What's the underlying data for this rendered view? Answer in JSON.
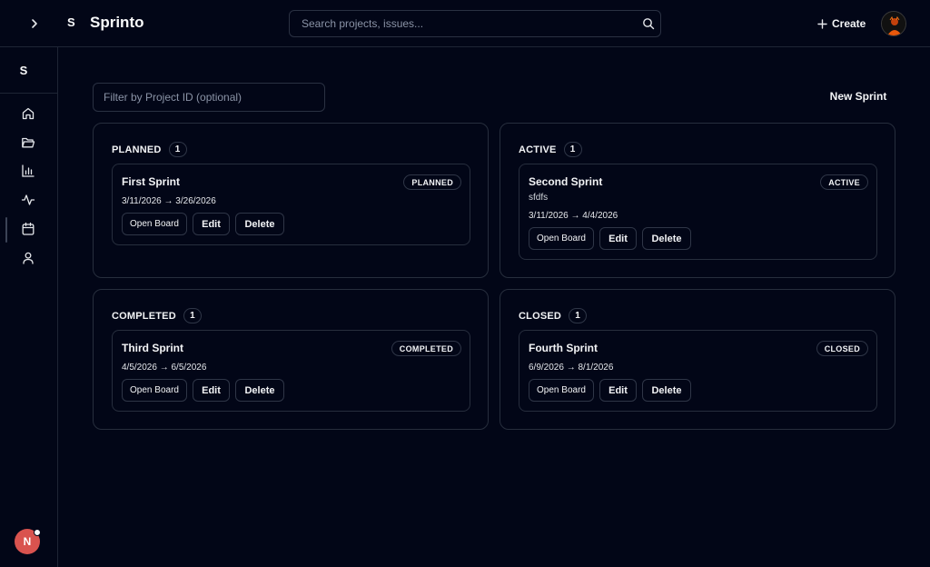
{
  "header": {
    "brand_initial": "S",
    "brand_name": "Sprinto",
    "search_placeholder": "Search projects, issues...",
    "create_label": "Create"
  },
  "sidebar": {
    "initial": "S",
    "items": [
      {
        "icon": "home-icon"
      },
      {
        "icon": "folder-icon"
      },
      {
        "icon": "bar-chart-icon"
      },
      {
        "icon": "activity-icon"
      },
      {
        "icon": "calendar-icon"
      },
      {
        "icon": "user-icon"
      }
    ],
    "active_index": 4,
    "user_initial": "N"
  },
  "toolbar": {
    "filter_placeholder": "Filter by Project ID (optional)",
    "new_sprint_label": "New Sprint"
  },
  "columns": [
    {
      "title": "PLANNED",
      "count": "1",
      "sprints": [
        {
          "name": "First Sprint",
          "status": "PLANNED",
          "description": "",
          "dates": "3/11/2026 → 3/26/2026"
        }
      ]
    },
    {
      "title": "ACTIVE",
      "count": "1",
      "sprints": [
        {
          "name": "Second Sprint",
          "status": "ACTIVE",
          "description": "sfdfs",
          "dates": "3/11/2026 → 4/4/2026"
        }
      ]
    },
    {
      "title": "COMPLETED",
      "count": "1",
      "sprints": [
        {
          "name": "Third Sprint",
          "status": "COMPLETED",
          "description": "",
          "dates": "4/5/2026 → 6/5/2026"
        }
      ]
    },
    {
      "title": "CLOSED",
      "count": "1",
      "sprints": [
        {
          "name": "Fourth Sprint",
          "status": "CLOSED",
          "description": "",
          "dates": "6/9/2026 → 8/1/2026"
        }
      ]
    }
  ],
  "card_actions": {
    "open_board": "Open Board",
    "edit": "Edit",
    "delete": "Delete"
  },
  "colors": {
    "background": "#020617",
    "border": "#272e3d",
    "text": "#f3f4f6",
    "user_avatar": "#d9534f"
  }
}
